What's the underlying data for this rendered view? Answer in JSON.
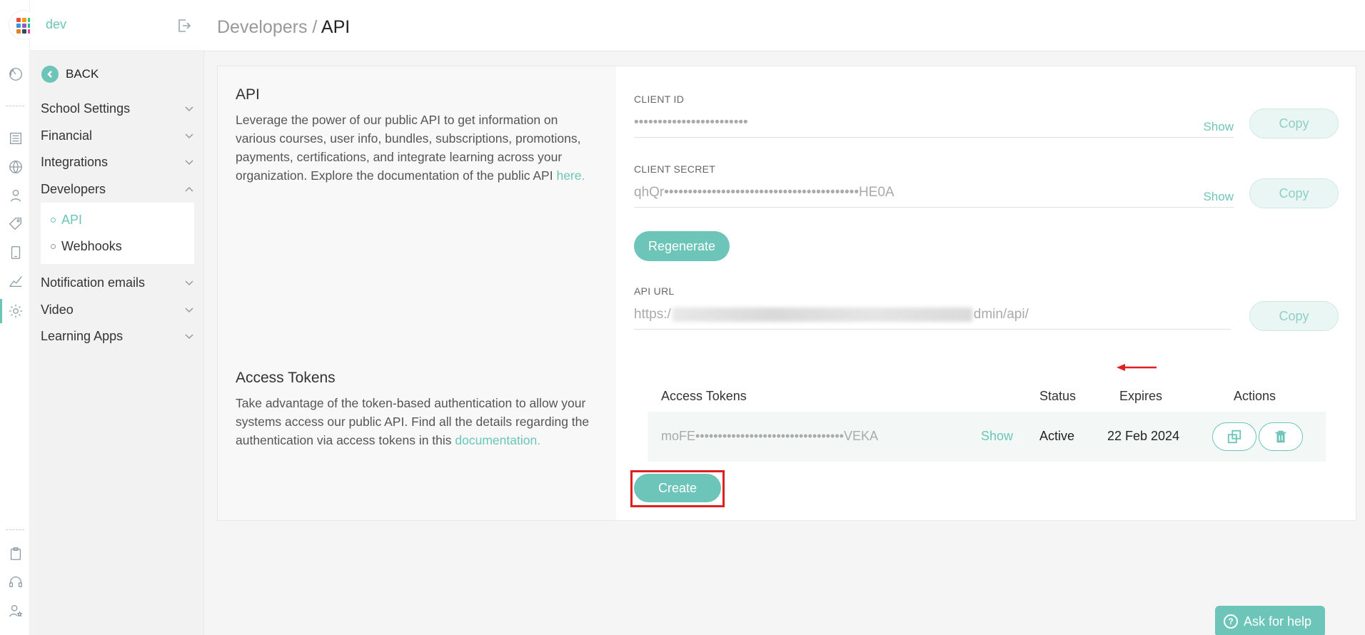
{
  "app": {
    "brand": "dev"
  },
  "sidebar": {
    "back_label": "BACK",
    "items": [
      {
        "label": "School Settings"
      },
      {
        "label": "Financial"
      },
      {
        "label": "Integrations"
      },
      {
        "label": "Developers"
      },
      {
        "label": "Notification emails"
      },
      {
        "label": "Video"
      },
      {
        "label": "Learning Apps"
      }
    ],
    "subitems": [
      {
        "label": "API"
      },
      {
        "label": "Webhooks"
      }
    ]
  },
  "header": {
    "crumb_parent": "Developers / ",
    "crumb_current": "API"
  },
  "api_section": {
    "title": "API",
    "desc": "Leverage the power of our public API to get information on various courses, user info, bundles, subscriptions, promotions, payments, certifications, and integrate learning across your organization. Explore the documentation of the public API ",
    "link": "here."
  },
  "tokens_section": {
    "title": "Access Tokens",
    "desc": "Take advantage of the token-based authentication to allow your systems access our public API. Find all the details regarding the authentication via access tokens in this ",
    "link": "documentation."
  },
  "credentials": {
    "client_id_label": "CLIENT ID",
    "client_id_value": "••••••••••••••••••••••••",
    "client_secret_label": "CLIENT SECRET",
    "client_secret_value": "qhQr•••••••••••••••••••••••••••••••••••••••••HE0A",
    "show_label": "Show",
    "copy_label": "Copy",
    "regenerate_label": "Regenerate",
    "api_url_label": "API URL",
    "api_url_prefix": "https:/",
    "api_url_suffix": "dmin/api/"
  },
  "tokens_table": {
    "headers": {
      "token": "Access Tokens",
      "status": "Status",
      "expires": "Expires",
      "actions": "Actions"
    },
    "rows": [
      {
        "token": "moFE•••••••••••••••••••••••••••••••••VEKA",
        "show": "Show",
        "status": "Active",
        "expires": "22 Feb 2024"
      }
    ],
    "create_label": "Create"
  },
  "help": {
    "label": "Ask for help",
    "glyph": "?"
  },
  "colors": {
    "accent": "#6cc5b8",
    "annotation": "#e02020"
  },
  "icons": [
    "logo-grid-icon",
    "dashboard-icon",
    "content-icon",
    "globe-icon",
    "users-icon",
    "tag-icon",
    "mobile-icon",
    "analytics-icon",
    "settings-icon",
    "clipboard-icon",
    "headset-icon",
    "user-star-icon",
    "logout-icon",
    "chevron-down-icon",
    "chevron-up-icon",
    "copy-icon",
    "trash-icon"
  ]
}
